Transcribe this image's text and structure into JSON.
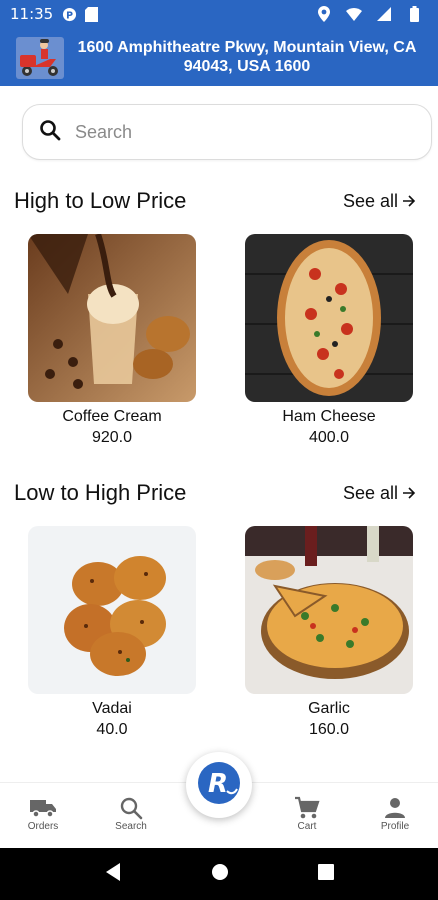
{
  "status_bar": {
    "time": "11:35",
    "icons": [
      "app-notification-icon",
      "sd-card-icon",
      "location-icon",
      "wifi-icon",
      "signal-icon",
      "battery-icon"
    ]
  },
  "header": {
    "logo_icon": "delivery-scooter-icon",
    "address": "1600 Amphitheatre Pkwy, Mountain View, CA 94043, USA 1600",
    "color": "#2a66c2"
  },
  "search": {
    "placeholder": "Search",
    "value": ""
  },
  "sections": [
    {
      "title": "High to Low Price",
      "see_all": "See all",
      "items": [
        {
          "name": "Coffee Cream",
          "price": "920.0",
          "image": "coffee-cream-image"
        },
        {
          "name": "Ham Cheese",
          "price": "400.0",
          "image": "ham-cheese-pizza-image"
        }
      ]
    },
    {
      "title": "Low to High Price",
      "see_all": "See all",
      "items": [
        {
          "name": "Vadai",
          "price": "40.0",
          "image": "vadai-image"
        },
        {
          "name": "Garlic",
          "price": "160.0",
          "image": "garlic-pizza-image"
        }
      ]
    }
  ],
  "bottom_nav": {
    "items": [
      {
        "label": "Orders",
        "icon": "truck-icon"
      },
      {
        "label": "Search",
        "icon": "search-icon"
      },
      {
        "label": "Cart",
        "icon": "cart-icon"
      },
      {
        "label": "Profile",
        "icon": "person-icon"
      }
    ],
    "fab_icon": "brand-r-logo-icon"
  },
  "system_nav": {
    "icons": [
      "back-icon",
      "home-icon",
      "recents-icon"
    ]
  }
}
